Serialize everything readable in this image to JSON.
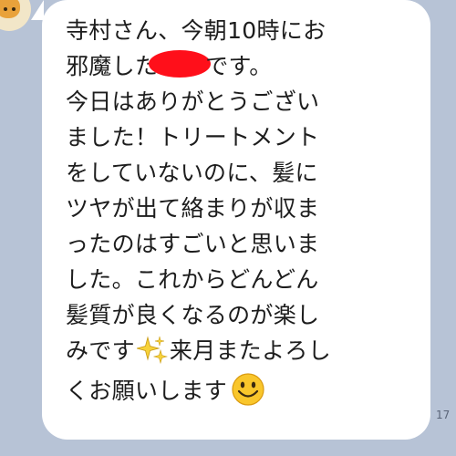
{
  "message": {
    "line1": "寺村さん、今朝10時にお",
    "line2_before": "邪魔した",
    "line2_after": "です。",
    "line3": "今日はありがとうござい",
    "line4": "ました！トリートメント",
    "line5": "をしていないのに、髪に",
    "line6": "ツヤが出て絡まりが収ま",
    "line7": "ったのはすごいと思いま",
    "line8": "した。これからどんどん",
    "line9": "髪質が良くなるのが楽し",
    "line10_before": "みです",
    "line10_after": "来月またよろし",
    "line11": "くお願いします"
  },
  "timestamp": "17",
  "icons": {
    "redaction": "red-redaction-mark",
    "emoji1": "sparkles-icon",
    "emoji2": "smiley-face-icon"
  },
  "colors": {
    "background": "#b7c3d6",
    "bubble": "#ffffff",
    "redaction": "#ff0f1a"
  }
}
